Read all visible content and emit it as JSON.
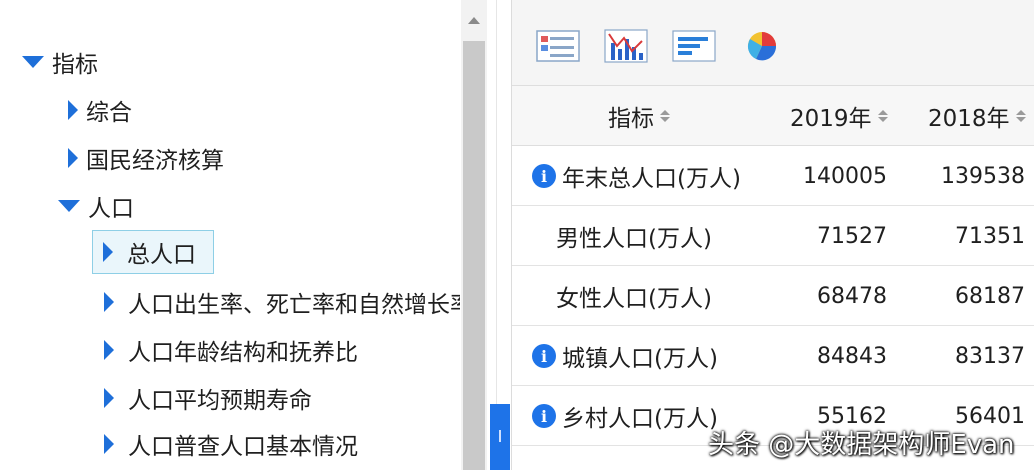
{
  "tree": {
    "items": [
      {
        "label": "指标",
        "expanded": true
      },
      {
        "label": "综合",
        "expanded": false
      },
      {
        "label": "国民经济核算",
        "expanded": false
      },
      {
        "label": "人口",
        "expanded": true
      },
      {
        "label": "总人口",
        "expanded": false,
        "selected": true
      },
      {
        "label": "人口出生率、死亡率和自然增长率",
        "expanded": false
      },
      {
        "label": "人口年龄结构和抚养比",
        "expanded": false
      },
      {
        "label": "人口平均预期寿命",
        "expanded": false
      },
      {
        "label": "人口普查人口基本情况",
        "expanded": false
      }
    ]
  },
  "toolbar": {
    "buttons": [
      "table-view-icon",
      "bar-line-chart-icon",
      "horizontal-bar-chart-icon",
      "pie-chart-icon"
    ]
  },
  "table": {
    "headers": {
      "indicator": "指标",
      "y2019": "2019年",
      "y2018": "2018年"
    },
    "rows": [
      {
        "name": "年末总人口(万人)",
        "v2019": "140005",
        "v2018": "139538",
        "info": true
      },
      {
        "name": "男性人口(万人)",
        "v2019": "71527",
        "v2018": "71351",
        "info": false
      },
      {
        "name": "女性人口(万人)",
        "v2019": "68478",
        "v2018": "68187",
        "info": false
      },
      {
        "name": "城镇人口(万人)",
        "v2019": "84843",
        "v2018": "83137",
        "info": true
      },
      {
        "name": "乡村人口(万人)",
        "v2019": "55162",
        "v2018": "56401",
        "info": true
      }
    ]
  },
  "watermark": "头条 @大数据架构师Evan",
  "colors": {
    "accent": "#1e73e8",
    "selected_bg": "#eaf6fb",
    "selected_border": "#8ecfe6"
  }
}
